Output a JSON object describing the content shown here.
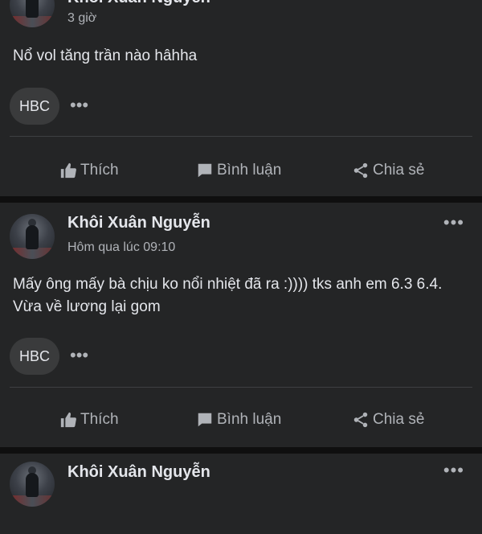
{
  "posts": [
    {
      "author": "Khôi Xuân Nguyễn",
      "time": "3 giờ",
      "content": "Nổ vol tăng trần nào hâhha",
      "tag": "HBC"
    },
    {
      "author": "Khôi Xuân Nguyễn",
      "time": "Hôm qua lúc 09:10",
      "content": "Mấy ông mấy bà chịu ko nổi nhiệt đã ra :)))) tks anh em 6.3 6.4. Vừa về lương lại gom",
      "tag": "HBC"
    },
    {
      "author": "Khôi Xuân Nguyễn"
    }
  ],
  "actions": {
    "like": "Thích",
    "comment": "Bình luận",
    "share": "Chia sẻ"
  },
  "more_glyph": "•••",
  "icons": [
    "like-icon",
    "comment-icon",
    "share-icon",
    "more-icon"
  ],
  "colors": {
    "background": "#0f0f0f",
    "card": "#242526",
    "text": "#e4e6eb",
    "muted": "#b0b3b8",
    "tag_bg": "#3a3b3c"
  }
}
